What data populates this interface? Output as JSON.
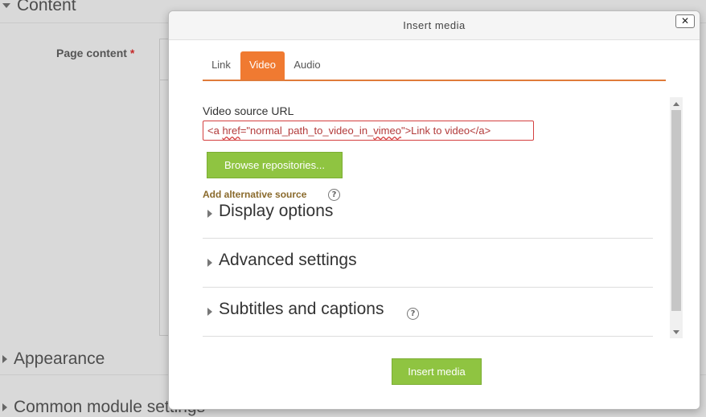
{
  "background": {
    "content_heading": "Content",
    "page_content_label": "Page content",
    "required_mark": "*",
    "appearance_heading": "Appearance",
    "common_heading": "Common module settings"
  },
  "modal": {
    "title": "Insert media",
    "close_glyph": "✕",
    "tabs": [
      {
        "label": "Link"
      },
      {
        "label": "Video"
      },
      {
        "label": "Audio"
      }
    ],
    "active_tab": "Video",
    "video_source_label": "Video source URL",
    "video_source_value_parts": [
      "<a ",
      "href",
      "=\"normal_path_to_video_in_",
      "vimeo",
      "\">Link to video</a>"
    ],
    "browse_button": "Browse repositories...",
    "add_alternative_source": "Add alternative source",
    "help_glyph": "?",
    "sections": [
      {
        "title": "Display options"
      },
      {
        "title": "Advanced settings"
      },
      {
        "title": "Subtitles and captions"
      }
    ],
    "insert_button": "Insert media"
  },
  "colors": {
    "accent_tab": "#f07a31",
    "primary_button": "#8fc441",
    "error_border": "#d43f3f"
  }
}
